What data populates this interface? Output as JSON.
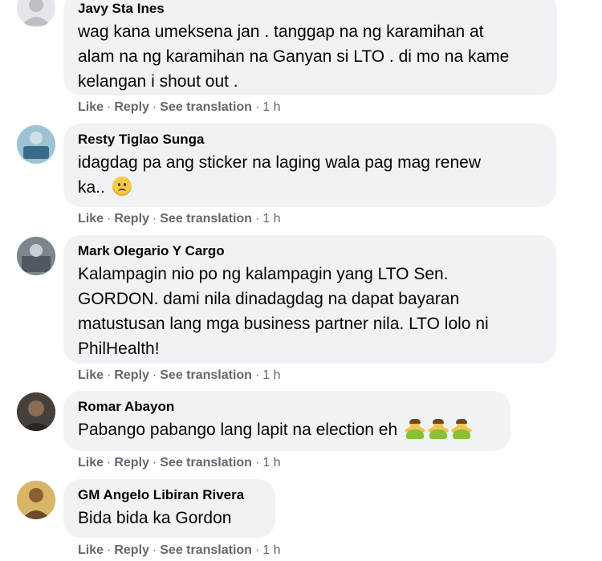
{
  "comments": [
    {
      "name": "Javy Sta Ines",
      "text": "wag kana umeksena jan . tanggap na ng karamihan at\nalam na ng karamihan na Ganyan si LTO . di mo na kame\nkelangan i shout out .",
      "like": "Like",
      "reply": "Reply",
      "translate": "See translation",
      "time": "1 h"
    },
    {
      "name": "Resty Tiglao Sunga",
      "text": "idagdag pa ang sticker na laging wala pag mag renew\nka..",
      "emoji": "frowning-face-emoji",
      "like": "Like",
      "reply": "Reply",
      "translate": "See translation",
      "time": "1 h"
    },
    {
      "name": "Mark Olegario Y Cargo",
      "text": "Kalampagin nio po ng kalampagin yang LTO Sen.\nGORDON. dami nila dinadagdag na dapat bayaran\nmatustusan lang mga business partner nila. LTO lolo ni\nPhilHealth!",
      "like": "Like",
      "reply": "Reply",
      "translate": "See translation",
      "time": "1 h"
    },
    {
      "name": "Romar Abayon",
      "text": "Pabango pabango lang lapit na election eh",
      "emoji": "person-gesturing-emoji x3",
      "like": "Like",
      "reply": "Reply",
      "translate": "See translation",
      "time": "1 h"
    },
    {
      "name": "GM Angelo Libiran Rivera",
      "text": "Bida bida ka Gordon",
      "like": "Like",
      "reply": "Reply",
      "translate": "See translation",
      "time": "1 h"
    }
  ],
  "colors": {
    "bubble": "#f0f2f5",
    "meta": "#65676b",
    "text": "#050505"
  }
}
